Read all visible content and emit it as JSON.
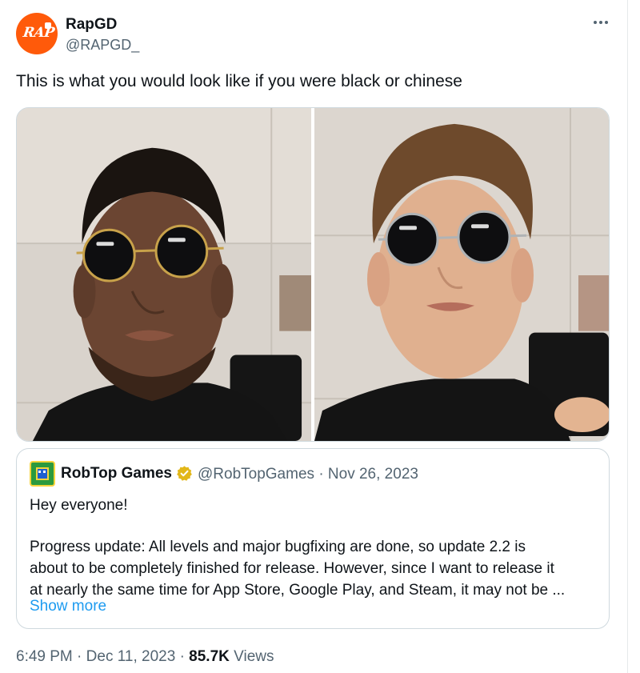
{
  "author": {
    "name": "RapGD",
    "handle": "@RAPGD_",
    "avatar_text": "RAP",
    "avatar_color": "#ff5a0a"
  },
  "tweet": {
    "text": "This is what you would look like if you were black or chinese"
  },
  "media": {
    "photos": [
      {
        "name": "photo-left",
        "subject": "selfie-man-dark-skin-round-sunglasses"
      },
      {
        "name": "photo-right",
        "subject": "selfie-man-light-skin-round-sunglasses"
      }
    ]
  },
  "quoted": {
    "name": "RobTop Games",
    "handle": "@RobTopGames",
    "separator": "·",
    "date": "Nov 26, 2023",
    "verified_icon": "gold-check-badge-icon",
    "lines": [
      "Hey everyone!",
      "Progress update: All levels and major bugfixing are done, so update 2.2 is",
      "about to be completely finished for release. However, since I want to release it",
      "at nearly the same time for App Store, Google Play, and Steam, it may not be ..."
    ],
    "show_more": "Show more"
  },
  "footer": {
    "time": "6:49 PM",
    "dot": "·",
    "date": "Dec 11, 2023",
    "dot2": "·",
    "views_count": "85.7K",
    "views_label": "Views"
  },
  "colors": {
    "link": "#1d9bf0",
    "muted": "#536471",
    "text": "#0f1419",
    "border": "#cfd9de"
  }
}
